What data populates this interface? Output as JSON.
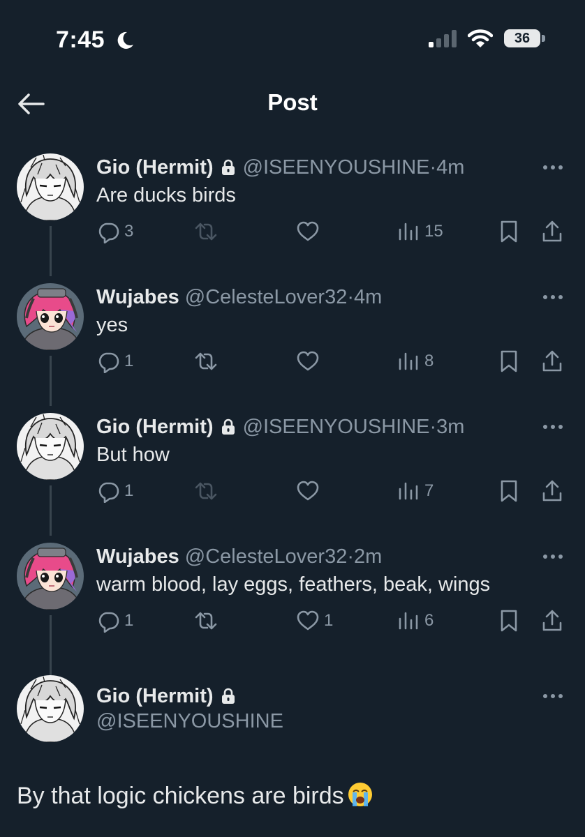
{
  "status_bar": {
    "time": "7:45",
    "battery": "36"
  },
  "header": {
    "title": "Post"
  },
  "tweets": [
    {
      "name": "Gio (Hermit)",
      "handle": "@ISEENYOUSHINE",
      "meta": "·4m",
      "text": "Are ducks birds",
      "replies": "3",
      "reposts": "",
      "likes": "",
      "views": "15",
      "avatar": "hermit",
      "locked": true,
      "retweet_dim": true
    },
    {
      "name": "Wujabes",
      "handle": "@CelesteLover32",
      "meta": "·4m",
      "text": "yes",
      "replies": "1",
      "reposts": "",
      "likes": "",
      "views": "8",
      "avatar": "pink",
      "locked": false,
      "retweet_dim": false
    },
    {
      "name": "Gio (Hermit)",
      "handle": "@ISEENYOUSHINE",
      "meta": "·3m",
      "text": "But how",
      "replies": "1",
      "reposts": "",
      "likes": "",
      "views": "7",
      "avatar": "hermit",
      "locked": true,
      "retweet_dim": true
    },
    {
      "name": "Wujabes",
      "handle": "@CelesteLover32",
      "meta": "·2m",
      "text": "warm blood, lay eggs, feathers, beak, wings",
      "replies": "1",
      "reposts": "",
      "likes": "1",
      "views": "6",
      "avatar": "pink",
      "locked": false,
      "retweet_dim": false
    }
  ],
  "main_tweet": {
    "name": "Gio (Hermit)",
    "handle": "@ISEENYOUSHINE",
    "text": "By that logic chickens are birds",
    "emoji": "loudly-crying-face-icon"
  },
  "colors": {
    "background": "#15202b",
    "text": "#e7e9ea",
    "muted": "#8b98a5",
    "thread_line": "#38444d"
  }
}
